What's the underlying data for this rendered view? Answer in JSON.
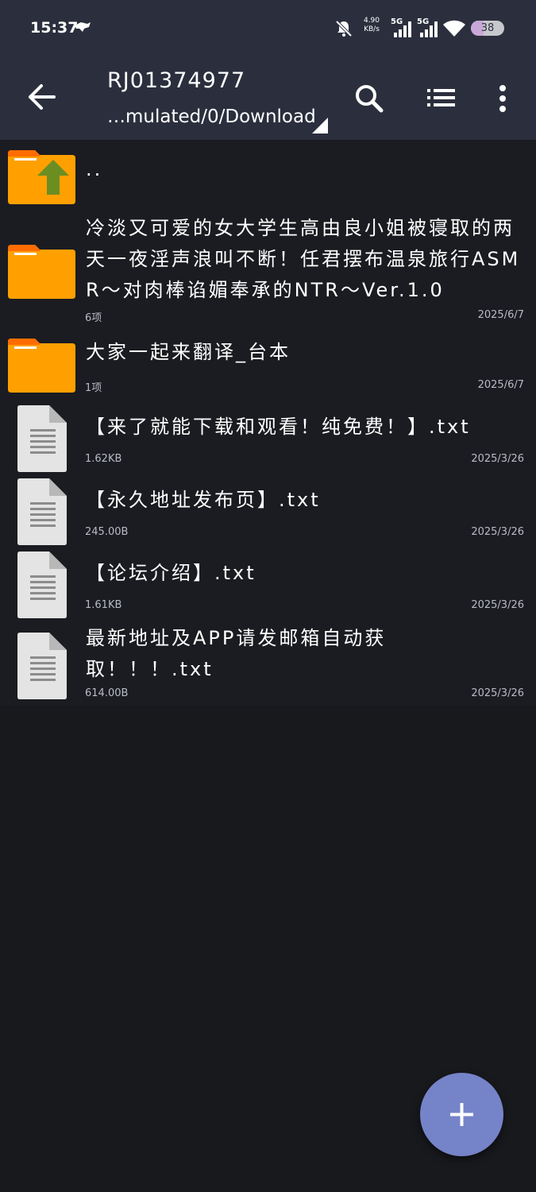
{
  "status_bar": {
    "time": "15:37",
    "net_speed_value": "4.90",
    "net_speed_unit": "KB/s",
    "signal1_label": "5G",
    "signal2_label": "5G",
    "battery_level": "38",
    "icons": [
      "app-notification-icon",
      "mute-bell-icon",
      "signal-icon",
      "signal-icon",
      "wifi-icon",
      "battery-icon"
    ]
  },
  "toolbar": {
    "title": "RJ01374977",
    "path": "…mulated/0/Download",
    "icons": [
      "back-arrow-icon",
      "search-icon",
      "list-view-icon",
      "more-vert-icon"
    ]
  },
  "files": [
    {
      "name": "..",
      "type": "parent-folder",
      "meta": "",
      "date": ""
    },
    {
      "name": "冷淡又可爱的女大学生高由良小姐被寝取的两天一夜淫声浪叫不断！任君摆布温泉旅行ASMR～对肉棒谄媚奉承的NTR～Ver.1.0",
      "type": "folder",
      "meta": "6项",
      "date": "2025/6/7"
    },
    {
      "name": "大家一起来翻译_台本",
      "type": "folder",
      "meta": "1项",
      "date": "2025/6/7"
    },
    {
      "name": "【来了就能下载和观看！纯免费！】.txt",
      "type": "file",
      "meta": "1.62KB",
      "date": "2025/3/26"
    },
    {
      "name": "【永久地址发布页】.txt",
      "type": "file",
      "meta": "245.00B",
      "date": "2025/3/26"
    },
    {
      "name": "【论坛介绍】.txt",
      "type": "file",
      "meta": "1.61KB",
      "date": "2025/3/26"
    },
    {
      "name": "最新地址及APP请发邮箱自动获取！！！.txt",
      "type": "file",
      "meta": "614.00B",
      "date": "2025/3/26"
    }
  ],
  "fab": {
    "icon": "plus-icon"
  },
  "colors": {
    "toolbar_bg": "#2b2f3d",
    "list_bg": "#1b1c21",
    "folder_orange": "#ffa000",
    "folder_tab": "#ff6d00",
    "up_arrow_green": "#6b8e23",
    "fab": "#7583c9"
  }
}
